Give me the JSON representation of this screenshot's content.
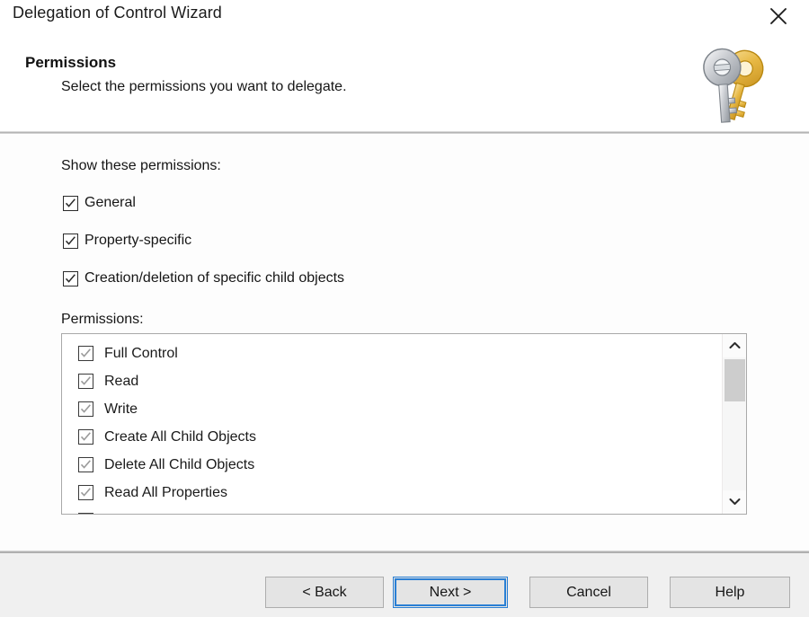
{
  "window": {
    "title": "Delegation of Control Wizard",
    "close_icon": "close-x-icon"
  },
  "header": {
    "title": "Permissions",
    "subtitle": "Select the permissions you want to delegate.",
    "icon": "two-keys-icon"
  },
  "main": {
    "show_label": "Show these permissions:",
    "show_options": [
      {
        "label": "General",
        "checked": true
      },
      {
        "label": "Property-specific",
        "checked": true
      },
      {
        "label": "Creation/deletion of specific child objects",
        "checked": true
      }
    ],
    "permissions_label": "Permissions:",
    "permissions": [
      {
        "label": "Full Control",
        "checked": true
      },
      {
        "label": "Read",
        "checked": true
      },
      {
        "label": "Write",
        "checked": true
      },
      {
        "label": "Create All Child Objects",
        "checked": true
      },
      {
        "label": "Delete All Child Objects",
        "checked": true
      },
      {
        "label": "Read All Properties",
        "checked": true
      }
    ],
    "scrollbar": {
      "up_icon": "chevron-up-icon",
      "down_icon": "chevron-down-icon"
    }
  },
  "footer": {
    "back_label": "< Back",
    "next_label": "Next >",
    "cancel_label": "Cancel",
    "help_label": "Help"
  },
  "colors": {
    "focus_blue": "#2a7fd4",
    "footer_bg": "#f0f0f0",
    "key_gold": "#e8b33c",
    "key_silver": "#b9bcc0"
  }
}
